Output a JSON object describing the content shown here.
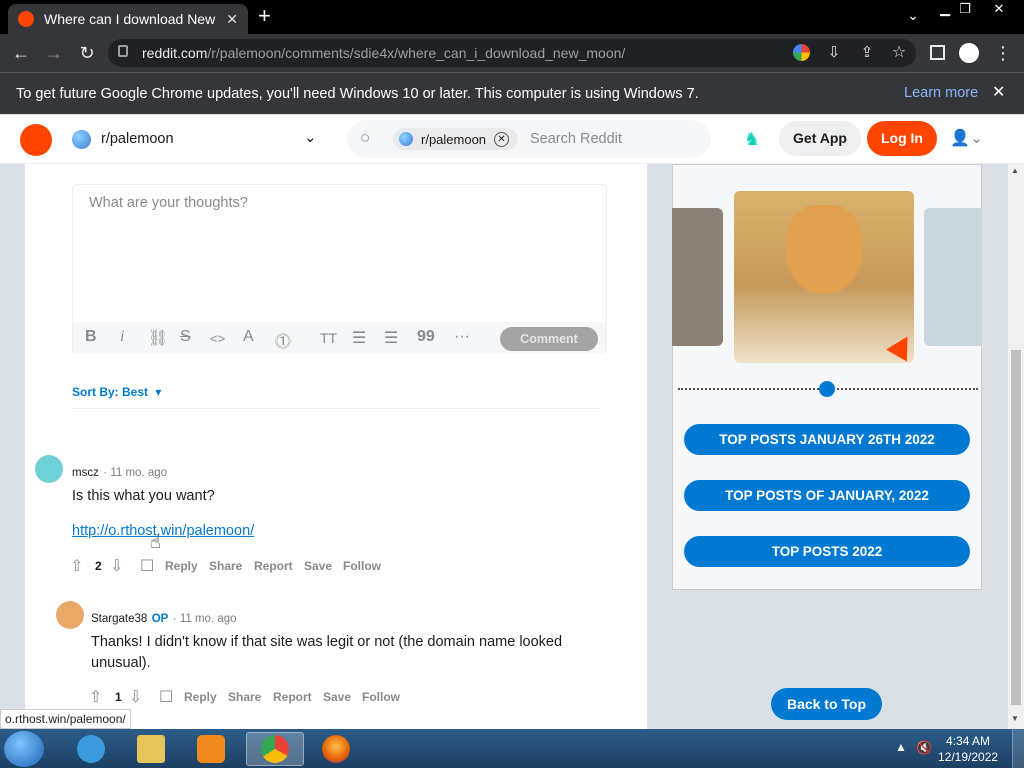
{
  "browser": {
    "tab_title": "Where can I download New M",
    "tab_close": "✕",
    "new_tab": "+",
    "url_host": "reddit.com",
    "url_path": "/r/palemoon/comments/sdie4x/where_can_i_download_new_moon/",
    "infobar_text": "To get future Google Chrome updates, you'll need Windows 10 or later. This computer is using Windows 7.",
    "infobar_link": "Learn more",
    "status_link": "o.rthost.win/palemoon/"
  },
  "reddit_header": {
    "subreddit": "r/palemoon",
    "search_chip": "r/palemoon",
    "search_placeholder": "Search Reddit",
    "get_app": "Get App",
    "log_in": "Log In"
  },
  "editor": {
    "placeholder": "What are your thoughts?",
    "comment_button": "Comment"
  },
  "sort": {
    "label": "Sort By: Best"
  },
  "comments": [
    {
      "author": "mscz",
      "time": "· 11 mo. ago",
      "text": "Is this what you want?",
      "link": "http://o.rthost.win/palemoon/",
      "votes": "2",
      "actions": [
        "Reply",
        "Share",
        "Report",
        "Save",
        "Follow"
      ]
    },
    {
      "author": "Stargate38",
      "op_badge": "OP",
      "time": "· 11 mo. ago",
      "text": "Thanks! I didn't know if that site was legit or not (the domain name looked unusual).",
      "votes": "1",
      "actions": [
        "Reply",
        "Share",
        "Report",
        "Save",
        "Follow"
      ]
    }
  ],
  "sidebar": {
    "buttons": [
      "TOP POSTS JANUARY 26TH 2022",
      "TOP POSTS OF JANUARY, 2022",
      "TOP POSTS 2022"
    ],
    "back_to_top": "Back to Top"
  },
  "taskbar": {
    "time": "4:34 AM",
    "date": "12/19/2022"
  },
  "colors": {
    "reddit_orange": "#ff4500",
    "reddit_blue": "#0079d3"
  }
}
